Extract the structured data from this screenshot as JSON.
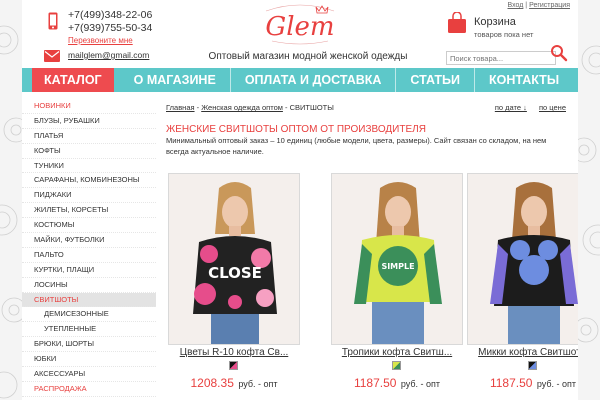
{
  "header": {
    "phone1": "+7(499)348-22-06",
    "phone2": "+7(939)755-50-34",
    "callback": "Перезвоните мне",
    "email": "mailglem@gmail.com",
    "logo_text": "Glem",
    "slogan": "Оптовый магазин модной женской одежды",
    "login": "Вход",
    "register": "Регистрация",
    "separator": "|",
    "cart_title": "Корзина",
    "cart_status": "товаров пока нет",
    "search_placeholder": "Поиск товара..."
  },
  "nav": {
    "items": [
      {
        "label": "Каталог"
      },
      {
        "label": "О магазине"
      },
      {
        "label": "Оплата и доставка"
      },
      {
        "label": "Статьи"
      },
      {
        "label": "Контакты"
      }
    ]
  },
  "sidebar": {
    "items": [
      {
        "label": "Новинки"
      },
      {
        "label": "Блузы, рубашки"
      },
      {
        "label": "Платья"
      },
      {
        "label": "Кофты"
      },
      {
        "label": "Туники"
      },
      {
        "label": "Сарафаны, комбинезоны"
      },
      {
        "label": "Пиджаки"
      },
      {
        "label": "Жилеты, корсеты"
      },
      {
        "label": "Костюмы"
      },
      {
        "label": "Майки, футболки"
      },
      {
        "label": "Пальто"
      },
      {
        "label": "Куртки, плащи"
      },
      {
        "label": "Лосины"
      },
      {
        "label": "Свитшоты"
      },
      {
        "label": "Демисезонные"
      },
      {
        "label": "Утепленные"
      },
      {
        "label": "Брюки, шорты"
      },
      {
        "label": "Юбки"
      },
      {
        "label": "Аксессуары"
      },
      {
        "label": "Распродажа"
      }
    ]
  },
  "breadcrumb": {
    "home": "Главная",
    "sep": " - ",
    "category": "Женская одежда оптом",
    "current": "СВИТШОТЫ"
  },
  "sort": {
    "by_date": "по дате ↓",
    "by_price": "по цене"
  },
  "main": {
    "title": "Женские свитшоты оптом от производителя",
    "description": "Минимальный оптовый заказ – 10 единиц (любые модели, цвета, размеры). Сайт связан со складом, на нем всегда актуальное наличие."
  },
  "products": [
    {
      "name": "Цветы R-10 кофта Св...",
      "price": "1208.35",
      "unit": "руб. - опт",
      "print_text": "CLOSE"
    },
    {
      "name": "Тропики кофта Свитш...",
      "price": "1187.50",
      "unit": "руб. - опт",
      "print_text": "SIMPLE"
    },
    {
      "name": "Микки кофта Свитшот...",
      "price": "1187.50",
      "unit": "руб. - опт",
      "print_text": ""
    }
  ],
  "colors": {
    "accent_teal": "#5dc8c9",
    "accent_red": "#ee4b4f",
    "text_red": "#e8403f"
  }
}
